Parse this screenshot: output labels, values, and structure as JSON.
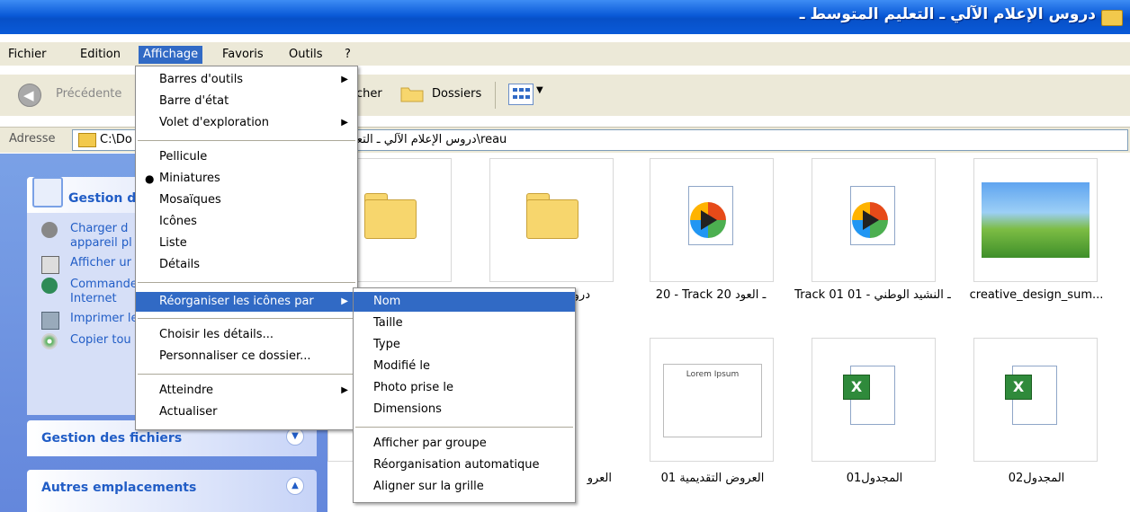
{
  "window": {
    "title": "دروس الإعلام الآلي ـ التعليم المتوسط ـ"
  },
  "menubar": {
    "items": [
      "Fichier",
      "Edition",
      "Affichage",
      "Favoris",
      "Outils",
      "?"
    ],
    "active": "Affichage"
  },
  "toolbar": {
    "back_label": "Précédente",
    "search_label": "cher",
    "folders_label": "Dossiers"
  },
  "address": {
    "label": "Adresse",
    "path_left": "C:\\Do",
    "path_right": "دروس الإعلام الآلي ـ التعليم المتوسط ـ\\reau"
  },
  "left_panel": {
    "main_box_title": "Gestion d",
    "tasks": [
      {
        "icon": "camera-icon",
        "label": "Charger d appareil pl"
      },
      {
        "icon": "print-icon",
        "label": "Afficher ur"
      },
      {
        "icon": "web-icon",
        "label": "Commande Internet"
      },
      {
        "icon": "printer-icon",
        "label": "Imprimer le"
      },
      {
        "icon": "cd-icon",
        "label": "Copier tou le CD"
      }
    ],
    "files_box_title": "Gestion des fichiers",
    "places_box_title": "Autres emplacements"
  },
  "content": {
    "items": [
      {
        "type": "folder",
        "label": ""
      },
      {
        "type": "folder",
        "label": "دروس السنة"
      },
      {
        "type": "media",
        "label": "20 - Track 20 ـ العود"
      },
      {
        "type": "media",
        "label": "Track 01 ـ النشيد الوطني - 01"
      },
      {
        "type": "image",
        "label": "creative_design_sum..."
      },
      {
        "type": "folder-partial",
        "label": "العرو"
      },
      {
        "type": "slide",
        "label": "العروض التقديمية 01",
        "slide_title": "Lorem Ipsum"
      },
      {
        "type": "excel",
        "label": "المجدول01"
      },
      {
        "type": "excel",
        "label": "المجدول02"
      }
    ]
  },
  "affichage_menu": {
    "items": [
      {
        "label": "Barres d'outils",
        "submenu": true
      },
      {
        "label": "Barre d'état"
      },
      {
        "label": "Volet d'exploration",
        "submenu": true
      },
      {
        "label": "Pellicule"
      },
      {
        "label": "Miniatures",
        "checked": true
      },
      {
        "label": "Mosaïques"
      },
      {
        "label": "Icônes"
      },
      {
        "label": "Liste"
      },
      {
        "label": "Détails"
      },
      {
        "label": "Réorganiser les icônes par",
        "submenu": true,
        "selected": true
      },
      {
        "label": "Choisir les détails..."
      },
      {
        "label": "Personnaliser ce dossier..."
      },
      {
        "label": "Atteindre",
        "submenu": true
      },
      {
        "label": "Actualiser"
      }
    ]
  },
  "arrange_menu": {
    "items": [
      {
        "label": "Nom",
        "selected": true
      },
      {
        "label": "Taille"
      },
      {
        "label": "Type"
      },
      {
        "label": "Modifié le"
      },
      {
        "label": "Photo prise le"
      },
      {
        "label": "Dimensions"
      },
      {
        "label": "Afficher par groupe"
      },
      {
        "label": "Réorganisation automatique"
      },
      {
        "label": "Aligner sur la grille"
      }
    ]
  },
  "colors": {
    "titlebar": "#0a5ad8",
    "menu_highlight": "#316ac5",
    "task_link": "#215dc6"
  }
}
